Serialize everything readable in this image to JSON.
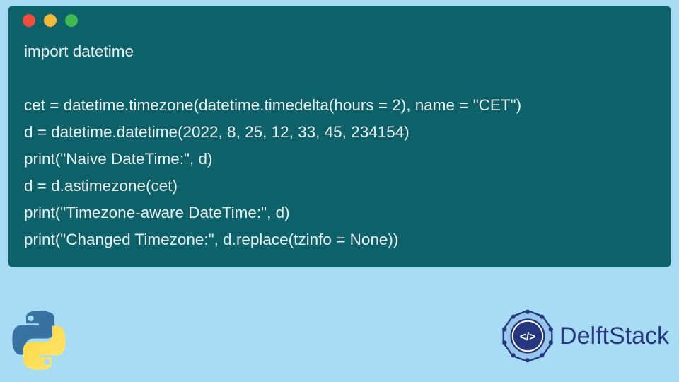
{
  "code": {
    "lines": [
      "import datetime",
      "",
      "cet = datetime.timezone(datetime.timedelta(hours = 2), name = \"CET\")",
      "d = datetime.datetime(2022, 8, 25, 12, 33, 45, 234154)",
      "print(\"Naive DateTime:\", d)",
      "d = d.astimezone(cet)",
      "print(\"Timezone-aware DateTime:\", d)",
      "print(\"Changed Timezone:\", d.replace(tzinfo = None))"
    ]
  },
  "window": {
    "dots": {
      "red": "#ef4e3c",
      "yellow": "#f0b93a",
      "green": "#3fb950"
    }
  },
  "branding": {
    "site_name": "DelftStack"
  }
}
